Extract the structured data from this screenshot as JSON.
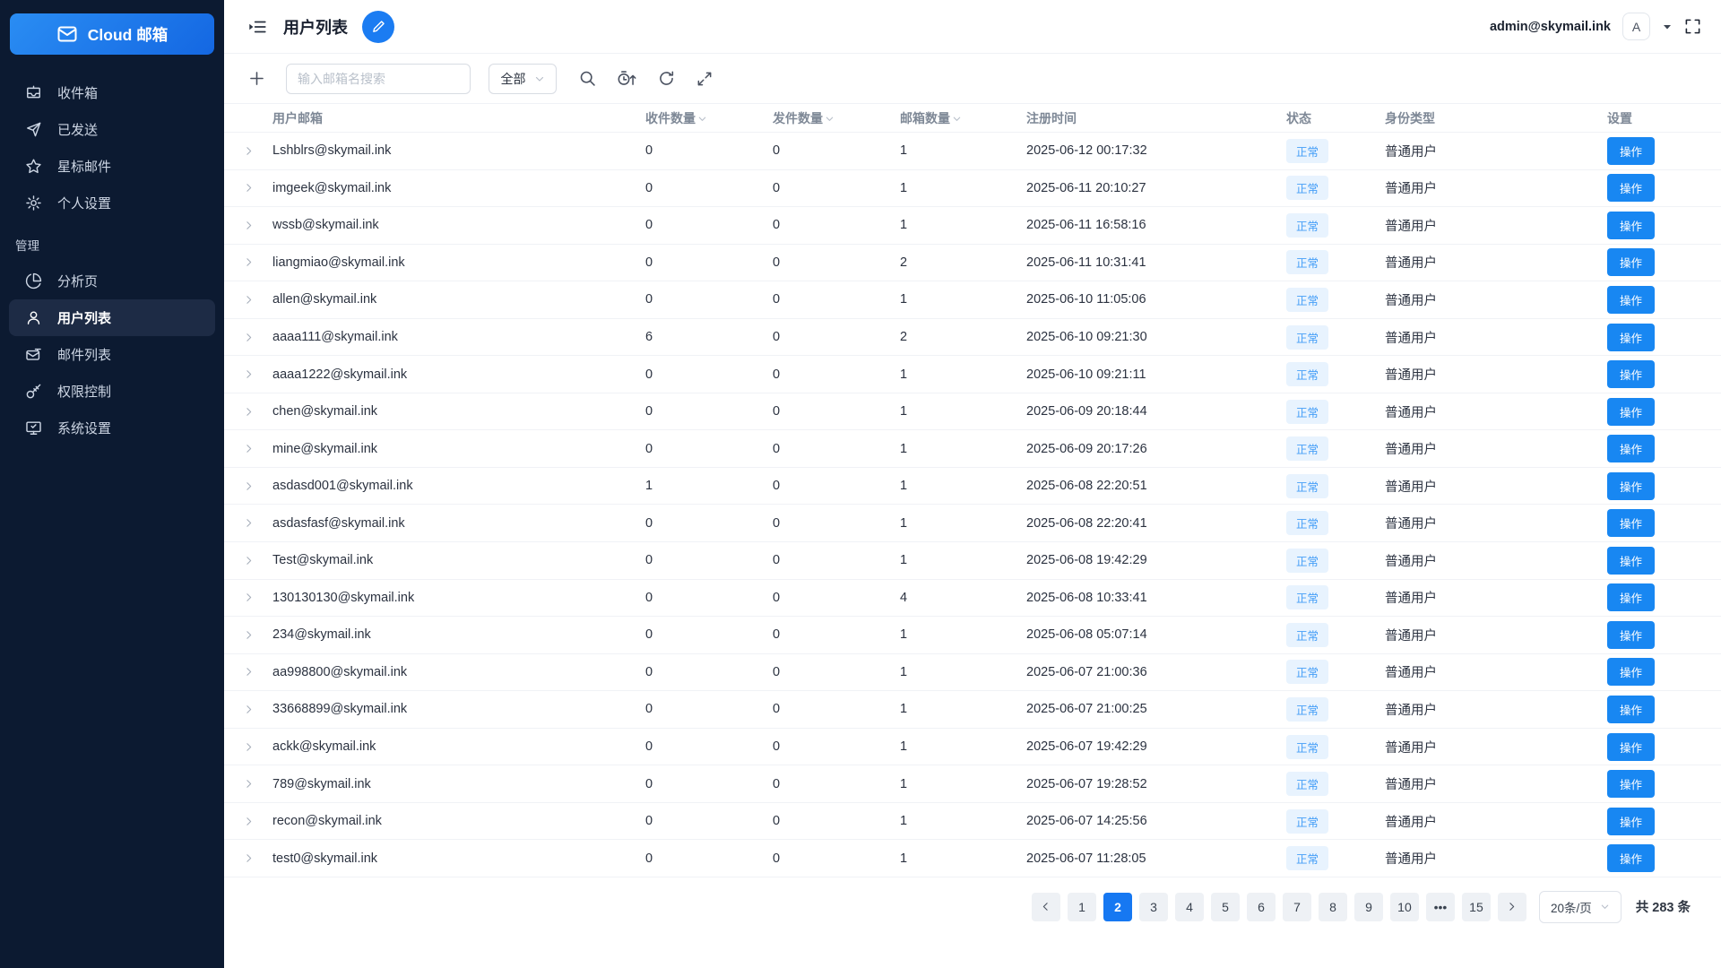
{
  "app": {
    "brand": "Cloud 邮箱",
    "admin_email": "admin@skymail.ink",
    "avatar_letter": "A"
  },
  "sidebar": {
    "section_label": "管理",
    "items": [
      {
        "label": "收件箱",
        "icon": "inbox-icon"
      },
      {
        "label": "已发送",
        "icon": "send-icon"
      },
      {
        "label": "星标邮件",
        "icon": "star-icon"
      },
      {
        "label": "个人设置",
        "icon": "gear-icon"
      },
      {
        "label": "分析页",
        "icon": "pie-chart-icon"
      },
      {
        "label": "用户列表",
        "icon": "user-icon",
        "active": true
      },
      {
        "label": "邮件列表",
        "icon": "mail-list-icon"
      },
      {
        "label": "权限控制",
        "icon": "key-icon"
      },
      {
        "label": "系统设置",
        "icon": "monitor-icon"
      }
    ]
  },
  "header": {
    "title": "用户列表"
  },
  "toolbar": {
    "search_placeholder": "输入邮箱名搜索",
    "filter_value": "全部"
  },
  "table": {
    "columns": [
      "用户邮箱",
      "收件数量",
      "发件数量",
      "邮箱数量",
      "注册时间",
      "状态",
      "身份类型",
      "设置"
    ],
    "action_label": "操作",
    "rows": [
      {
        "email": "Lshblrs@skymail.ink",
        "inbox": "0",
        "sent": "0",
        "mailboxes": "1",
        "registered": "2025-06-12 00:17:32",
        "status": "正常",
        "role": "普通用户"
      },
      {
        "email": "imgeek@skymail.ink",
        "inbox": "0",
        "sent": "0",
        "mailboxes": "1",
        "registered": "2025-06-11 20:10:27",
        "status": "正常",
        "role": "普通用户"
      },
      {
        "email": "wssb@skymail.ink",
        "inbox": "0",
        "sent": "0",
        "mailboxes": "1",
        "registered": "2025-06-11 16:58:16",
        "status": "正常",
        "role": "普通用户"
      },
      {
        "email": "liangmiao@skymail.ink",
        "inbox": "0",
        "sent": "0",
        "mailboxes": "2",
        "registered": "2025-06-11 10:31:41",
        "status": "正常",
        "role": "普通用户"
      },
      {
        "email": "allen@skymail.ink",
        "inbox": "0",
        "sent": "0",
        "mailboxes": "1",
        "registered": "2025-06-10 11:05:06",
        "status": "正常",
        "role": "普通用户"
      },
      {
        "email": "aaaa111@skymail.ink",
        "inbox": "6",
        "sent": "0",
        "mailboxes": "2",
        "registered": "2025-06-10 09:21:30",
        "status": "正常",
        "role": "普通用户"
      },
      {
        "email": "aaaa1222@skymail.ink",
        "inbox": "0",
        "sent": "0",
        "mailboxes": "1",
        "registered": "2025-06-10 09:21:11",
        "status": "正常",
        "role": "普通用户"
      },
      {
        "email": "chen@skymail.ink",
        "inbox": "0",
        "sent": "0",
        "mailboxes": "1",
        "registered": "2025-06-09 20:18:44",
        "status": "正常",
        "role": "普通用户"
      },
      {
        "email": "mine@skymail.ink",
        "inbox": "0",
        "sent": "0",
        "mailboxes": "1",
        "registered": "2025-06-09 20:17:26",
        "status": "正常",
        "role": "普通用户"
      },
      {
        "email": "asdasd001@skymail.ink",
        "inbox": "1",
        "sent": "0",
        "mailboxes": "1",
        "registered": "2025-06-08 22:20:51",
        "status": "正常",
        "role": "普通用户"
      },
      {
        "email": "asdasfasf@skymail.ink",
        "inbox": "0",
        "sent": "0",
        "mailboxes": "1",
        "registered": "2025-06-08 22:20:41",
        "status": "正常",
        "role": "普通用户"
      },
      {
        "email": "Test@skymail.ink",
        "inbox": "0",
        "sent": "0",
        "mailboxes": "1",
        "registered": "2025-06-08 19:42:29",
        "status": "正常",
        "role": "普通用户"
      },
      {
        "email": "130130130@skymail.ink",
        "inbox": "0",
        "sent": "0",
        "mailboxes": "4",
        "registered": "2025-06-08 10:33:41",
        "status": "正常",
        "role": "普通用户"
      },
      {
        "email": "234@skymail.ink",
        "inbox": "0",
        "sent": "0",
        "mailboxes": "1",
        "registered": "2025-06-08 05:07:14",
        "status": "正常",
        "role": "普通用户"
      },
      {
        "email": "aa998800@skymail.ink",
        "inbox": "0",
        "sent": "0",
        "mailboxes": "1",
        "registered": "2025-06-07 21:00:36",
        "status": "正常",
        "role": "普通用户"
      },
      {
        "email": "33668899@skymail.ink",
        "inbox": "0",
        "sent": "0",
        "mailboxes": "1",
        "registered": "2025-06-07 21:00:25",
        "status": "正常",
        "role": "普通用户"
      },
      {
        "email": "ackk@skymail.ink",
        "inbox": "0",
        "sent": "0",
        "mailboxes": "1",
        "registered": "2025-06-07 19:42:29",
        "status": "正常",
        "role": "普通用户"
      },
      {
        "email": "789@skymail.ink",
        "inbox": "0",
        "sent": "0",
        "mailboxes": "1",
        "registered": "2025-06-07 19:28:52",
        "status": "正常",
        "role": "普通用户"
      },
      {
        "email": "recon@skymail.ink",
        "inbox": "0",
        "sent": "0",
        "mailboxes": "1",
        "registered": "2025-06-07 14:25:56",
        "status": "正常",
        "role": "普通用户"
      },
      {
        "email": "test0@skymail.ink",
        "inbox": "0",
        "sent": "0",
        "mailboxes": "1",
        "registered": "2025-06-07 11:28:05",
        "status": "正常",
        "role": "普通用户"
      }
    ]
  },
  "pagination": {
    "pages": [
      {
        "label": "1"
      },
      {
        "label": "2",
        "active": true
      },
      {
        "label": "3"
      },
      {
        "label": "4"
      },
      {
        "label": "5"
      },
      {
        "label": "6"
      },
      {
        "label": "7"
      },
      {
        "label": "8"
      },
      {
        "label": "9"
      },
      {
        "label": "10"
      },
      {
        "label": "•••"
      },
      {
        "label": "15"
      }
    ],
    "page_size": "20条/页",
    "total": "共 283 条"
  },
  "colors": {
    "accent_blue": "#1678f2",
    "sidebar_bg": "#0c1a31",
    "badge_bg": "#e8f3fe",
    "badge_text": "#459ef7"
  }
}
